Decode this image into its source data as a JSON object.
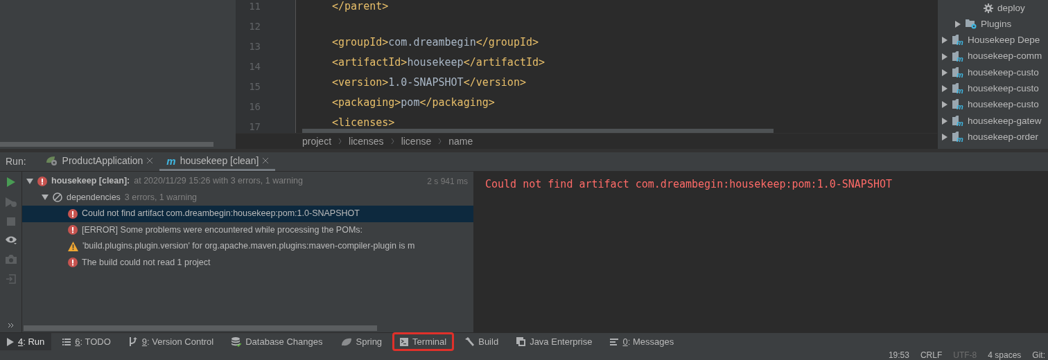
{
  "editor": {
    "lines": [
      {
        "number": "11",
        "tokens": [
          {
            "kind": "tag",
            "text": "</parent>"
          }
        ]
      },
      {
        "number": "12"
      },
      {
        "number": "13",
        "tokens": [
          {
            "kind": "tag",
            "text": "<groupId>"
          },
          {
            "kind": "text",
            "text": "com.dreambegin"
          },
          {
            "kind": "tag",
            "text": "</groupId>"
          }
        ]
      },
      {
        "number": "14",
        "tokens": [
          {
            "kind": "tag",
            "text": "<artifactId>"
          },
          {
            "kind": "text",
            "text": "housekeep"
          },
          {
            "kind": "tag",
            "text": "</artifactId>"
          }
        ]
      },
      {
        "number": "15",
        "tokens": [
          {
            "kind": "tag",
            "text": "<version>"
          },
          {
            "kind": "text",
            "text": "1.0-SNAPSHOT"
          },
          {
            "kind": "tag",
            "text": "</version>"
          }
        ]
      },
      {
        "number": "16",
        "tokens": [
          {
            "kind": "tag",
            "text": "<packaging>"
          },
          {
            "kind": "text",
            "text": "pom"
          },
          {
            "kind": "tag",
            "text": "</packaging>"
          }
        ]
      },
      {
        "number": "17",
        "tokens": [
          {
            "kind": "tag",
            "text": "<licenses>"
          }
        ]
      }
    ],
    "breadcrumbs": [
      "project",
      "licenses",
      "license",
      "name"
    ]
  },
  "maven_tree": {
    "items": [
      {
        "kind": "goal",
        "label": "deploy"
      },
      {
        "kind": "folder",
        "label": "Plugins"
      },
      {
        "kind": "module",
        "glyph": "m",
        "label": "Housekeep Depe"
      },
      {
        "kind": "module",
        "glyph": "m",
        "label": "housekeep-comm"
      },
      {
        "kind": "module",
        "glyph": "m",
        "label": "housekeep-custo"
      },
      {
        "kind": "module",
        "glyph": "m",
        "label": "housekeep-custo"
      },
      {
        "kind": "module",
        "glyph": "m",
        "label": "housekeep-custo"
      },
      {
        "kind": "module",
        "glyph": "m",
        "label": "housekeep-gatew"
      },
      {
        "kind": "module",
        "glyph": "m",
        "label": "housekeep-order"
      }
    ]
  },
  "run": {
    "label": "Run:",
    "tabs": [
      {
        "kind": "spring",
        "label": "ProductApplication",
        "selected": false
      },
      {
        "kind": "maven",
        "glyph": "m",
        "label": "housekeep [clean]",
        "selected": true
      }
    ],
    "tree": [
      {
        "kind": "error",
        "label": "housekeep [clean]:",
        "detail": "at 2020/11/29 15:26 with 3 errors, 1 warning",
        "time": "2 s 941 ms",
        "expanded": true,
        "selected": false,
        "children": [
          {
            "kind": "skipped",
            "label": "dependencies",
            "detail": "3 errors, 1 warning",
            "expanded": true,
            "selected": false,
            "children": [
              {
                "kind": "error",
                "label": "Could not find artifact com.dreambegin:housekeep:pom:1.0-SNAPSHOT",
                "selected": true
              },
              {
                "kind": "error",
                "label": "[ERROR] Some problems were encountered while processing the POMs:",
                "selected": false
              },
              {
                "kind": "warning",
                "label": "'build.plugins.plugin.version' for org.apache.maven.plugins:maven-compiler-plugin is m",
                "selected": false
              },
              {
                "kind": "error",
                "label": "The build could not read 1 project",
                "selected": false
              }
            ]
          }
        ]
      }
    ],
    "output": "Could not find artifact com.dreambegin:housekeep:pom:1.0-SNAPSHOT"
  },
  "tool_windows": [
    {
      "kind": "run",
      "key": "4",
      "label": ": Run",
      "selected": true,
      "highlighted": false
    },
    {
      "kind": "todo",
      "key": "6",
      "label": ": TODO",
      "selected": false,
      "highlighted": false
    },
    {
      "kind": "vcs",
      "key": "9",
      "label": ": Version Control",
      "selected": false,
      "highlighted": false
    },
    {
      "kind": "database",
      "label": "Database Changes",
      "selected": false,
      "highlighted": false
    },
    {
      "kind": "spring",
      "label": "Spring",
      "selected": false,
      "highlighted": false
    },
    {
      "kind": "terminal",
      "label": "Terminal",
      "selected": false,
      "highlighted": true
    },
    {
      "kind": "build",
      "label": "Build",
      "selected": false,
      "highlighted": false
    },
    {
      "kind": "javaee",
      "label": "Java Enterprise",
      "selected": false,
      "highlighted": false
    },
    {
      "kind": "messages",
      "key": "0",
      "label": ": Messages",
      "selected": false,
      "highlighted": false
    }
  ],
  "status_bar": [
    {
      "text": "19:53",
      "dimmed": false
    },
    {
      "text": "CRLF",
      "dimmed": false
    },
    {
      "text": "UTF-8",
      "dimmed": true
    },
    {
      "text": "4 spaces",
      "dimmed": false
    },
    {
      "text": "Git:",
      "dimmed": false
    }
  ]
}
